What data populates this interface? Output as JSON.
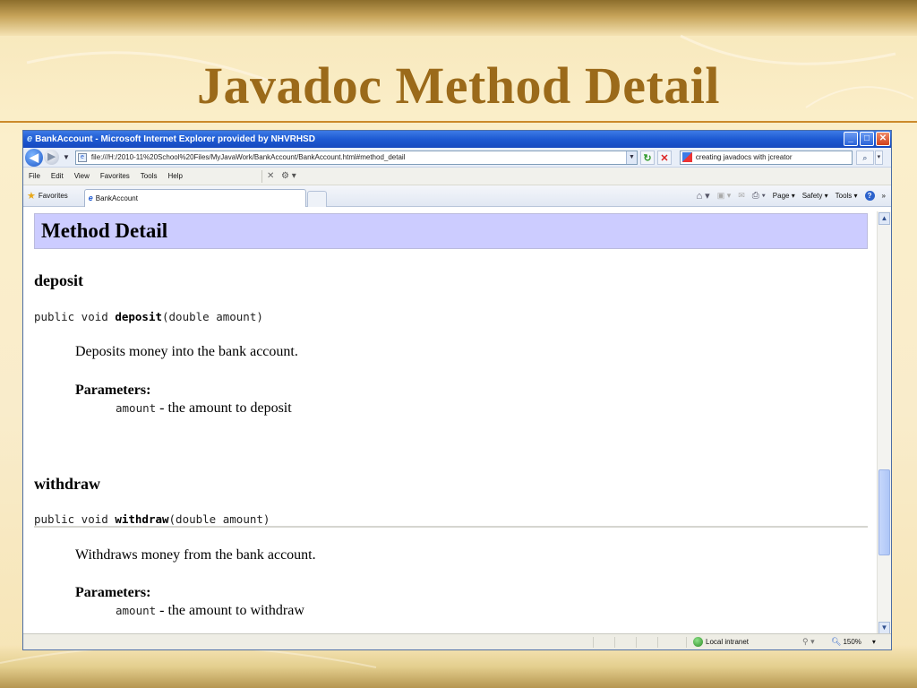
{
  "slide": {
    "title": "Javadoc Method Detail"
  },
  "window": {
    "title": "BankAccount - Microsoft Internet Explorer provided by NHVRHSD",
    "buttons": {
      "minimize": "_",
      "maximize": "□",
      "close": "✕"
    }
  },
  "address_bar": {
    "url": "file:///H:/2010-11%20School%20Files/MyJavaWork/BankAccount/BankAccount.html#method_detail",
    "search_text": "creating javadocs with jcreator"
  },
  "menu": {
    "items": [
      "File",
      "Edit",
      "View",
      "Favorites",
      "Tools",
      "Help"
    ]
  },
  "favorites_bar": {
    "favorites_label": "Favorites",
    "tab_label": "BankAccount",
    "commands": {
      "page": "Page ▾",
      "safety": "Safety ▾",
      "tools": "Tools ▾",
      "more": "»"
    }
  },
  "content": {
    "section_title": "Method Detail",
    "methods": [
      {
        "name": "deposit",
        "sig_prefix": "public void ",
        "sig_name": "deposit",
        "sig_params": "(double amount)",
        "description": "Deposits money into the bank account.",
        "params_label": "Parameters:",
        "param_name": "amount",
        "param_desc": " - the amount to deposit"
      },
      {
        "name": "withdraw",
        "sig_prefix": "public void ",
        "sig_name": "withdraw",
        "sig_params": "(double amount)",
        "description": "Withdraws money from the bank account.",
        "params_label": "Parameters:",
        "param_name": "amount",
        "param_desc": " - the amount to withdraw"
      }
    ]
  },
  "status_bar": {
    "zone": "Local intranet",
    "zoom": "150%"
  },
  "colors": {
    "title_gold": "#9b6a1a",
    "section_header_bg": "#ccccff",
    "ie_blue": "#1d59d2"
  }
}
